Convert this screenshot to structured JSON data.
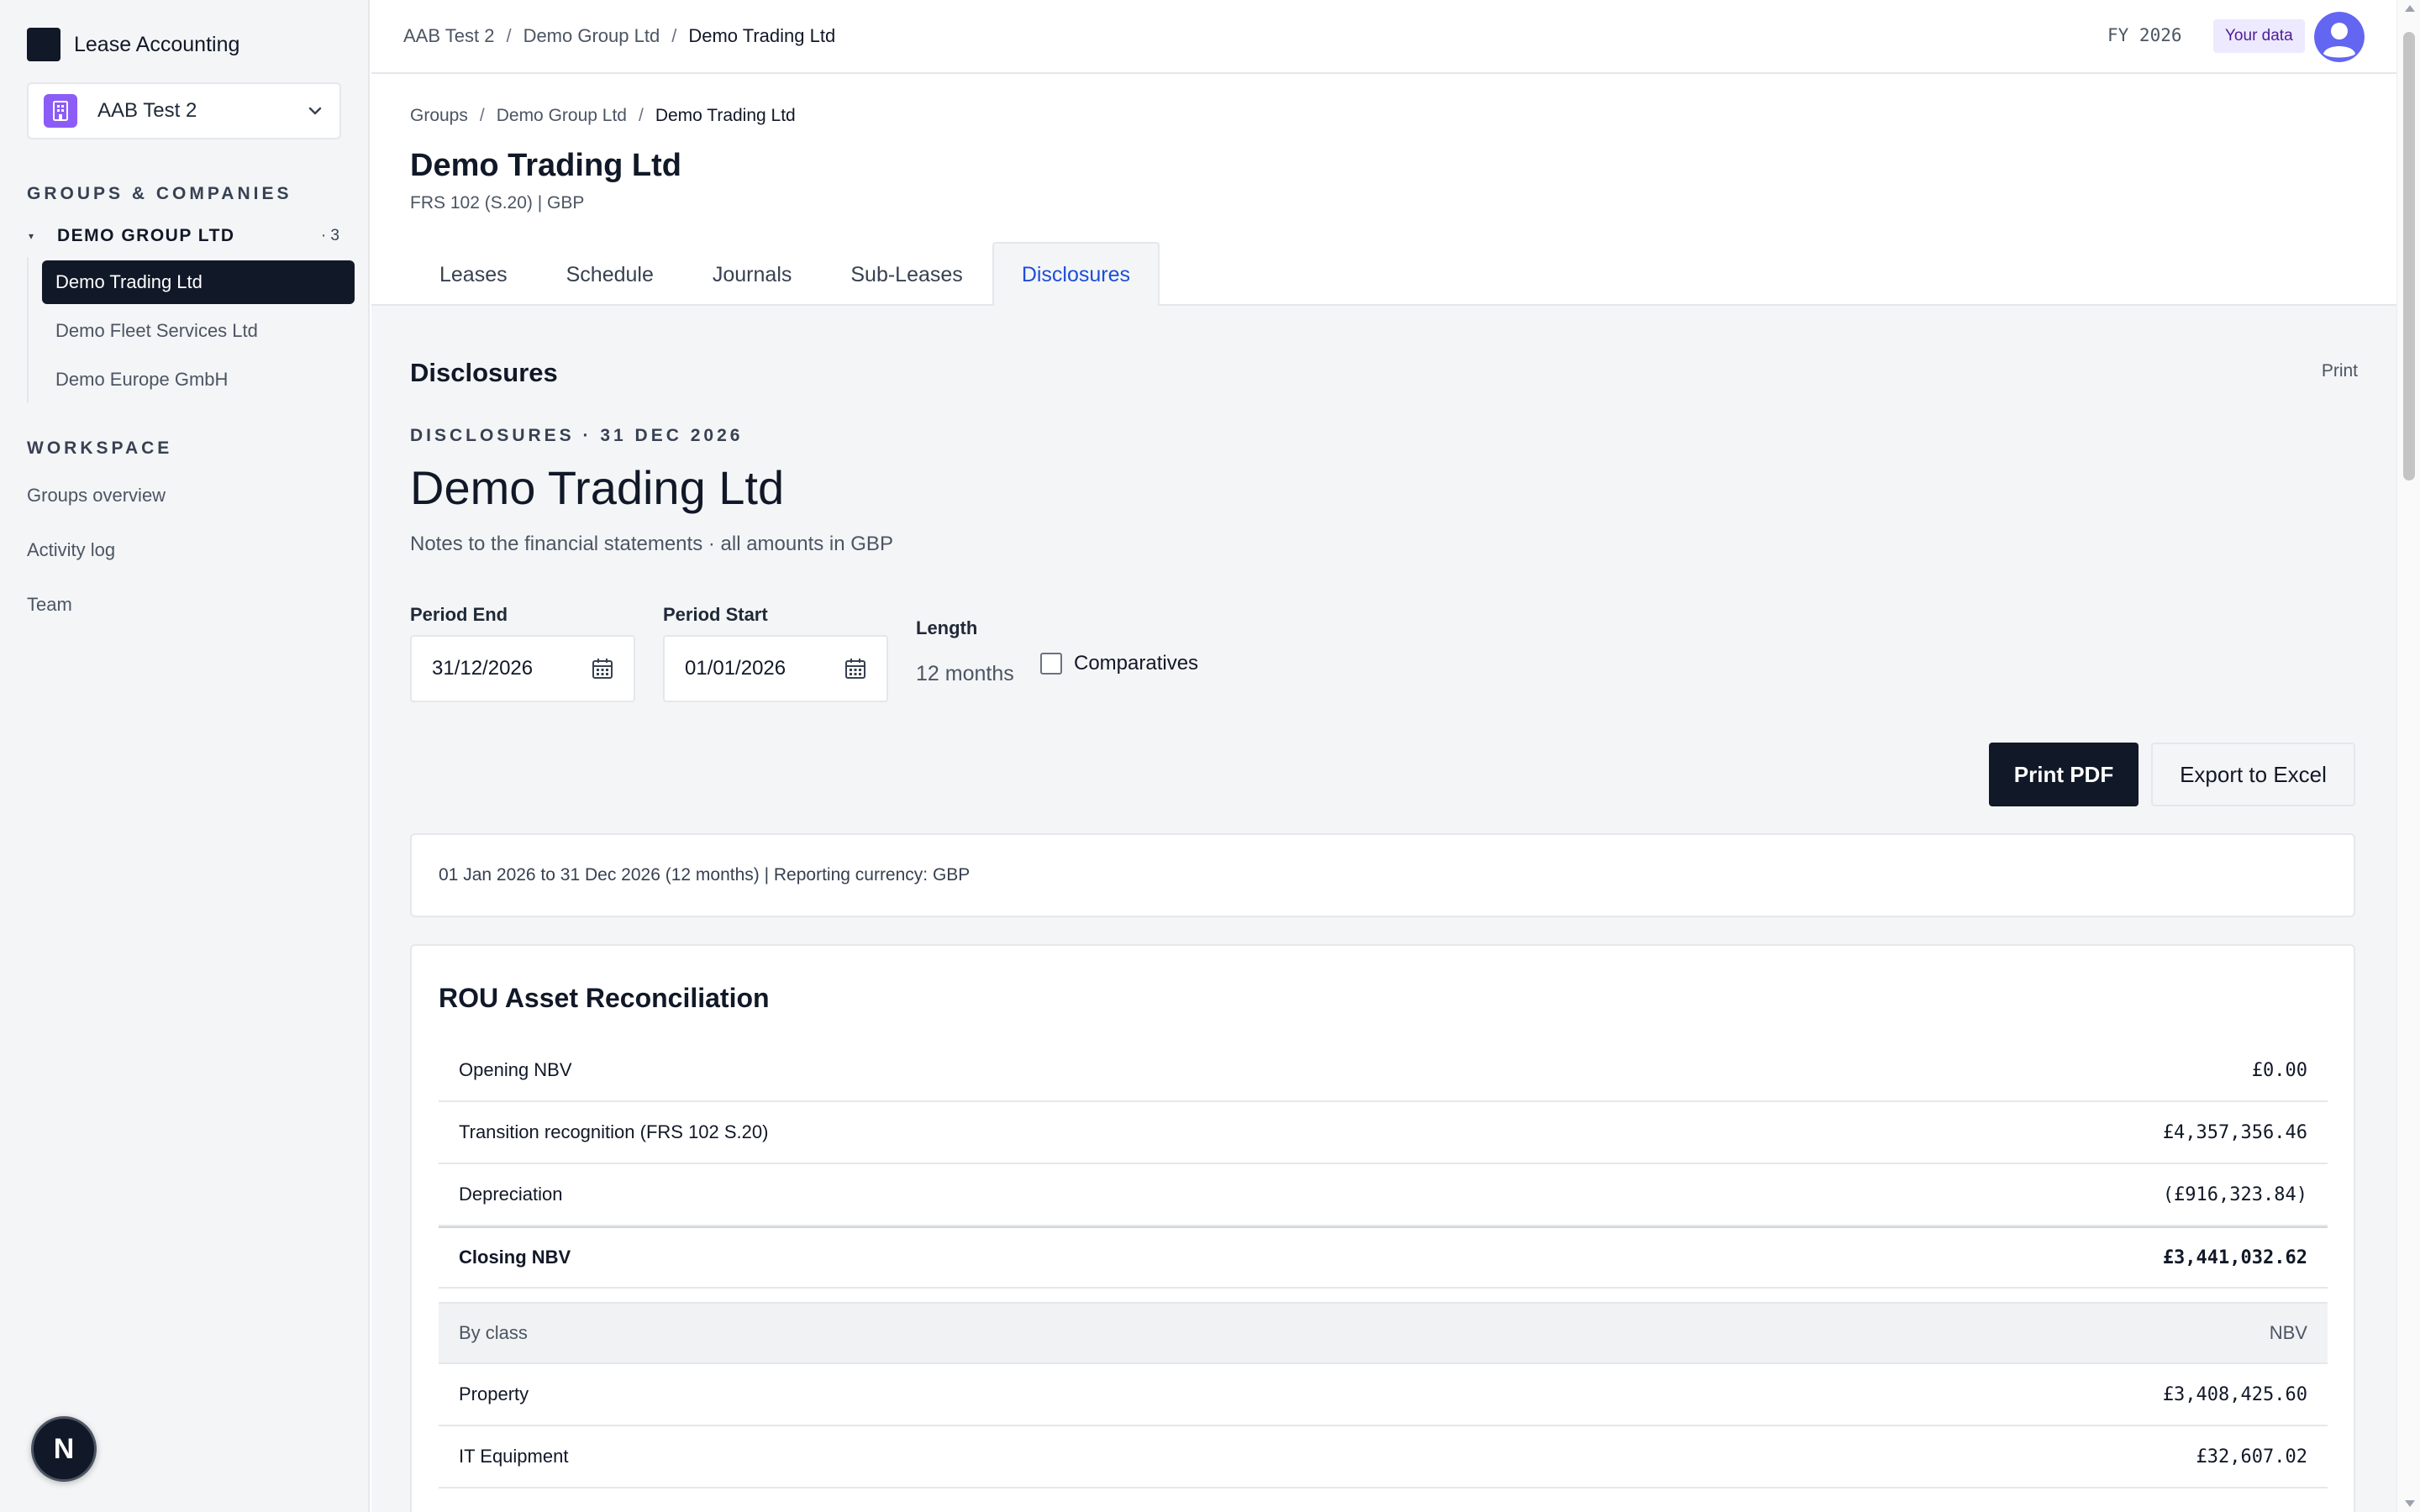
{
  "app": {
    "brand_name": "Lease Accounting"
  },
  "sidebar": {
    "company_switcher": {
      "name": "AAB Test 2",
      "icon": "building-icon"
    },
    "groups_label": "GROUPS & COMPANIES",
    "group": {
      "name": "DEMO GROUP LTD",
      "count": "· 3"
    },
    "companies": [
      {
        "label": "Demo Trading Ltd",
        "active": true
      },
      {
        "label": "Demo Fleet Services Ltd",
        "active": false
      },
      {
        "label": "Demo Europe GmbH",
        "active": false
      }
    ],
    "workspace_label": "WORKSPACE",
    "workspace_items": [
      {
        "label": "Groups overview"
      },
      {
        "label": "Activity log"
      },
      {
        "label": "Team"
      }
    ],
    "badge": "N"
  },
  "topbar": {
    "breadcrumbs": [
      "AAB Test 2",
      "Demo Group Ltd",
      "Demo Trading Ltd"
    ],
    "fiscal_year": "FY 2026",
    "your_data": "Your data",
    "separator": "/"
  },
  "header": {
    "breadcrumbs": [
      "Groups",
      "Demo Group Ltd",
      "Demo Trading Ltd"
    ],
    "title": "Demo Trading Ltd",
    "subtitle": "FRS 102 (S.20) | GBP",
    "tabs": [
      {
        "label": "Leases",
        "active": false
      },
      {
        "label": "Schedule",
        "active": false
      },
      {
        "label": "Journals",
        "active": false
      },
      {
        "label": "Sub-Leases",
        "active": false
      },
      {
        "label": "Disclosures",
        "active": true
      }
    ]
  },
  "main": {
    "section_title": "Disclosures",
    "print_label": "Print",
    "eyebrow": "DISCLOSURES · 31 DEC 2026",
    "doc_title": "Demo Trading Ltd",
    "doc_subtitle": "Notes to the financial statements · all amounts in GBP",
    "period_end": {
      "label": "Period End",
      "value": "31/12/2026"
    },
    "period_start": {
      "label": "Period Start",
      "value": "01/01/2026"
    },
    "length": {
      "label": "Length",
      "value": "12 months"
    },
    "comparatives": {
      "label": "Comparatives",
      "checked": false
    },
    "print_pdf": "Print PDF",
    "export_excel": "Export to Excel",
    "info": "01 Jan 2026 to 31 Dec 2026 (12 months) | Reporting currency: GBP",
    "rou_card": {
      "title": "ROU Asset Reconciliation",
      "rows": [
        {
          "label": "Opening NBV",
          "amount": "£0.00"
        },
        {
          "label": "Transition recognition (FRS 102 S.20)",
          "amount": "£4,357,356.46"
        },
        {
          "label": "Depreciation",
          "amount": "(£916,323.84)"
        }
      ],
      "total": {
        "label": "Closing NBV",
        "amount": "£3,441,032.62"
      },
      "class_header": {
        "label": "By class",
        "value": "NBV"
      },
      "class_rows": [
        {
          "label": "Property",
          "amount": "£3,408,425.60"
        },
        {
          "label": "IT Equipment",
          "amount": "£32,607.02"
        }
      ]
    }
  },
  "colors": {
    "primary": "#111827",
    "accent_purple": "#8b5cf6",
    "tab_active": "#1d4ed8",
    "avatar": "#6366f1",
    "badge_bg": "#ede9fe"
  }
}
